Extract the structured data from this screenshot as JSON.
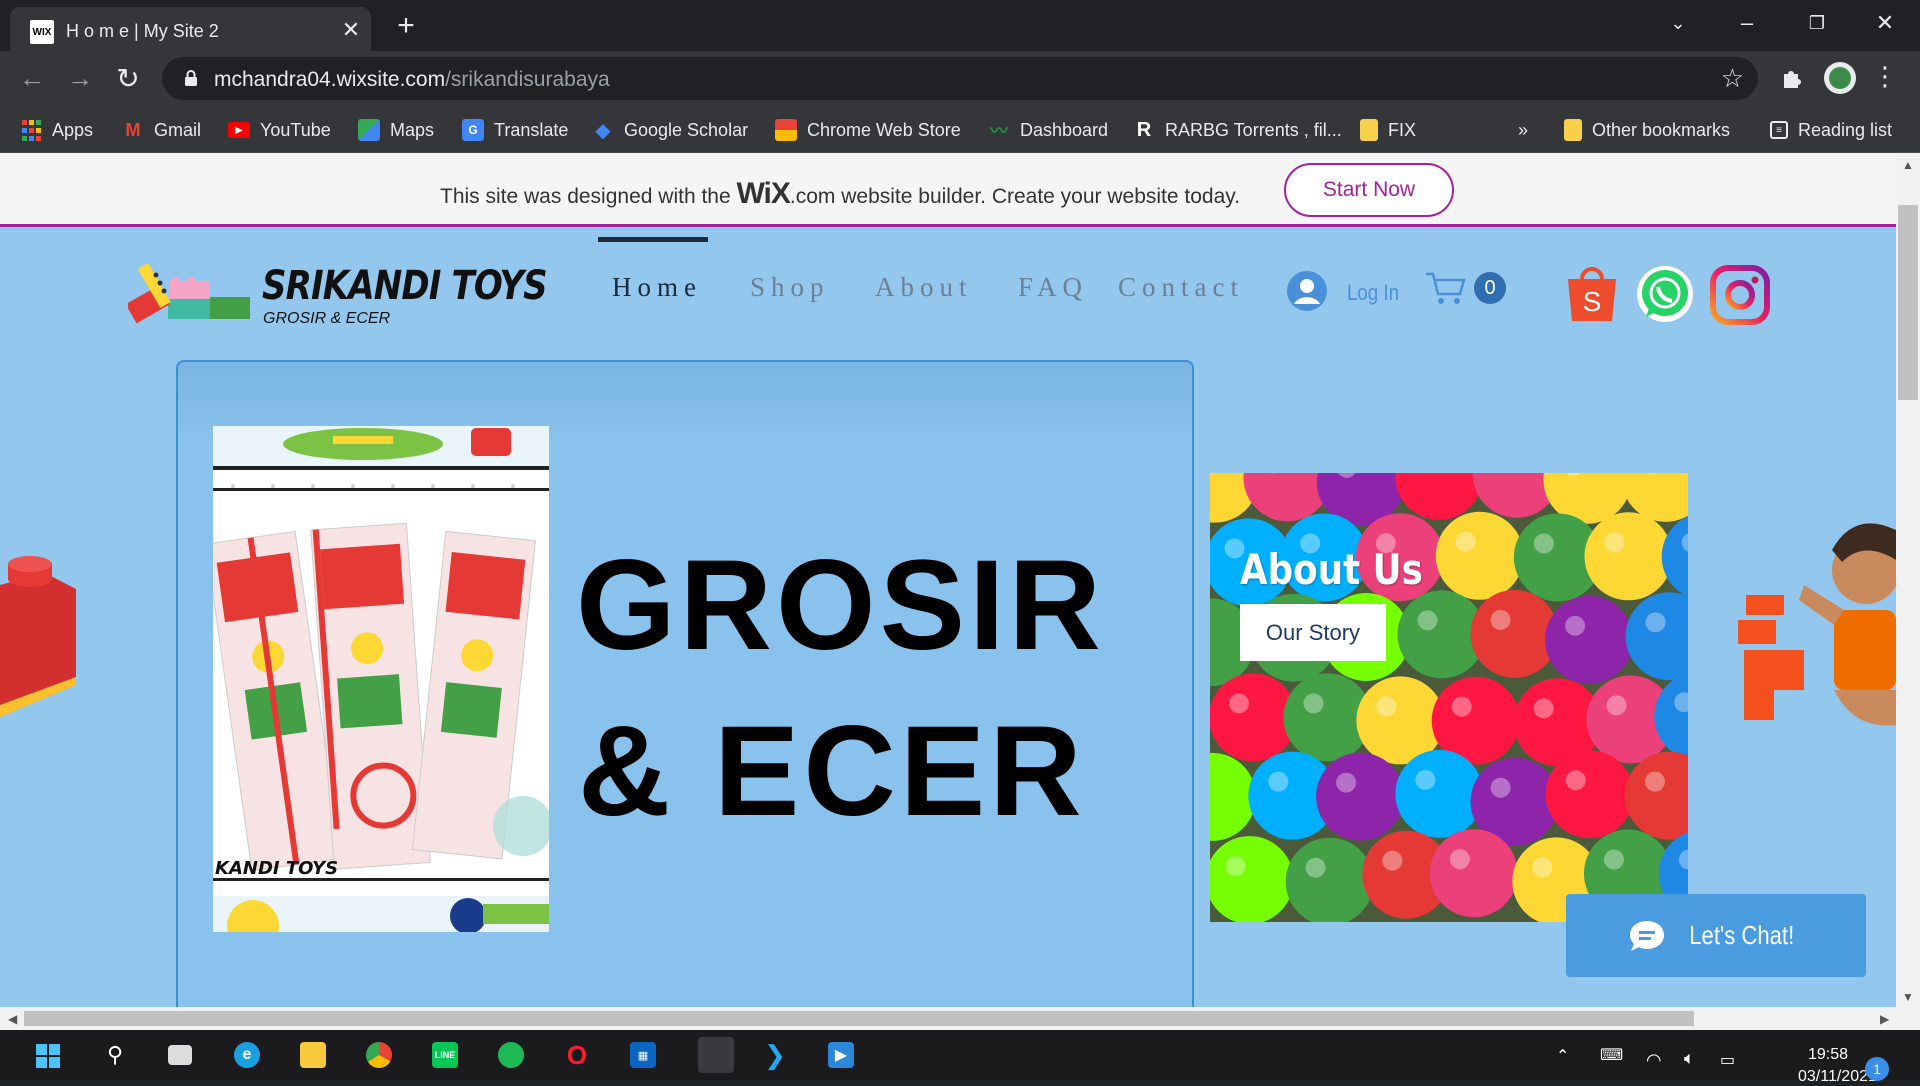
{
  "browser": {
    "tab_title": "H o m e | My Site 2",
    "tab_favicon": "WIX",
    "url_host": "mchandra04.wixsite.com",
    "url_path": "/srikandisurabaya",
    "bookmarks": [
      {
        "label": "Apps",
        "icon": "apps-icon"
      },
      {
        "label": "Gmail",
        "icon": "gmail-icon"
      },
      {
        "label": "YouTube",
        "icon": "youtube-icon"
      },
      {
        "label": "Maps",
        "icon": "maps-icon"
      },
      {
        "label": "Translate",
        "icon": "translate-icon"
      },
      {
        "label": "Google Scholar",
        "icon": "scholar-icon"
      },
      {
        "label": "Chrome Web Store",
        "icon": "webstore-icon"
      },
      {
        "label": "Dashboard",
        "icon": "dashboard-icon"
      },
      {
        "label": "RARBG Torrents , fil...",
        "icon": "rarbg-icon"
      },
      {
        "label": "FIX",
        "icon": "folder-icon"
      }
    ],
    "overflow": "»",
    "other_bookmarks": "Other bookmarks",
    "reading_list": "Reading list"
  },
  "wix_banner": {
    "text_before": "This site was designed with the ",
    "brand": "WiX",
    "text_after": ".com website builder. Create your website today.",
    "cta": "Start Now"
  },
  "site": {
    "logo_name": "SRIKANDI TOYS",
    "logo_sub": "GROSIR & ECER",
    "nav": [
      "Home",
      "Shop",
      "About",
      "FAQ",
      "Contact"
    ],
    "login": "Log In",
    "cart_count": "0",
    "hero_line1": "GROSIR",
    "hero_line2": "& ECER",
    "product_logo": "KANDI TOYS",
    "about_title": "About Us",
    "about_button": "Our Story",
    "chat": "Let's Chat!",
    "colors": {
      "background": "#93c7ee",
      "wix_accent": "#a2229c",
      "hero_border": "#3b8fd4",
      "chat": "#4a9be0"
    }
  },
  "taskbar": {
    "time": "19:58",
    "date": "03/11/2021",
    "notifications": "1"
  }
}
